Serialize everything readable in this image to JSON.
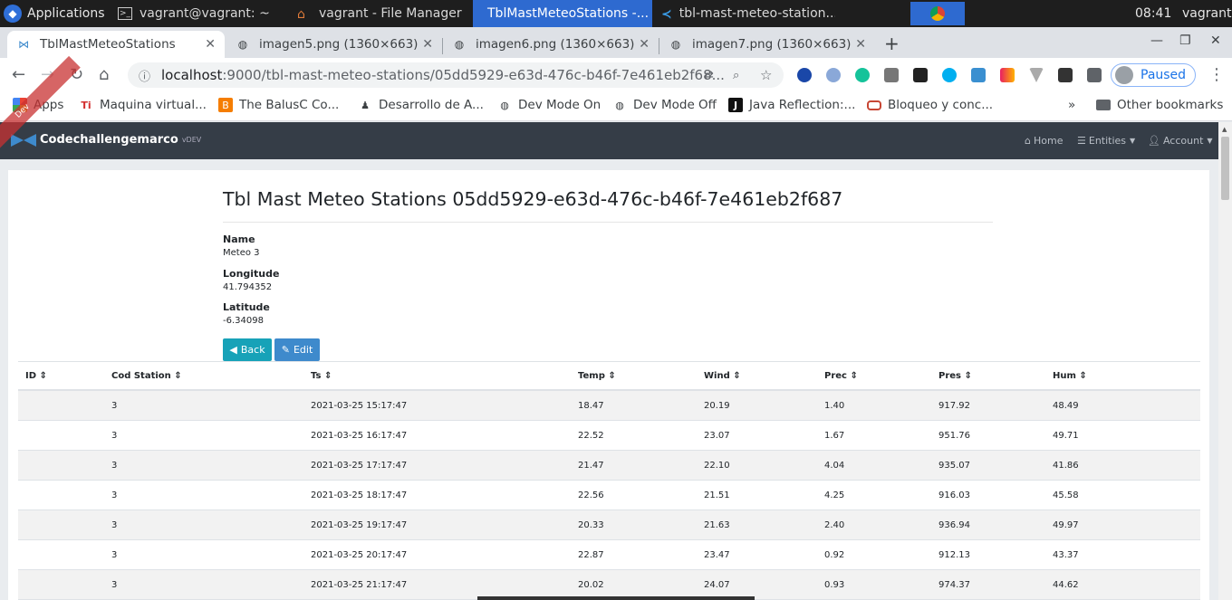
{
  "desktop": {
    "apps_label": "Applications",
    "tasks": [
      {
        "label": "vagrant@vagrant: ~",
        "icon": "terminal-icon"
      },
      {
        "label": "vagrant - File Manager",
        "icon": "home-folder-icon"
      },
      {
        "label": "TblMastMeteoStations -...",
        "icon": "chrome-icon"
      },
      {
        "label": "tbl-mast-meteo-station...",
        "icon": "vscode-icon"
      }
    ],
    "time": "08:41",
    "user": "vagrant"
  },
  "tabs": [
    {
      "label": "TblMastMeteoStations",
      "active": true
    },
    {
      "label": "imagen5.png (1360×663)"
    },
    {
      "label": "imagen6.png (1360×663)"
    },
    {
      "label": "imagen7.png (1360×663)"
    }
  ],
  "address": {
    "host": "localhost",
    "path": ":9000/tbl-mast-meteo-stations/05dd5929-e63d-476c-b46f-7e461eb2f68..."
  },
  "profile_status": "Paused",
  "bookmarks": [
    {
      "label": "Apps"
    },
    {
      "label": "Maquina virtual..."
    },
    {
      "label": "The BalusC Co..."
    },
    {
      "label": "Desarrollo de A..."
    },
    {
      "label": "Dev Mode On"
    },
    {
      "label": "Dev Mode Off"
    },
    {
      "label": "Java Reflection:..."
    },
    {
      "label": "Bloqueo y conc..."
    }
  ],
  "bookmarks_more": "»",
  "other_bookmarks": "Other bookmarks",
  "app": {
    "brand": "Codechallengemarco",
    "version": "vDEV",
    "ribbon": "Dev",
    "nav": {
      "home": "Home",
      "entities": "Entities",
      "account": "Account"
    }
  },
  "detail": {
    "title": "Tbl Mast Meteo Stations 05dd5929-e63d-476c-b46f-7e461eb2f687",
    "fields": [
      {
        "label": "Name",
        "value": "Meteo 3"
      },
      {
        "label": "Longitude",
        "value": "41.794352"
      },
      {
        "label": "Latitude",
        "value": "-6.34098"
      }
    ],
    "back_label": "Back",
    "edit_label": "Edit"
  },
  "table": {
    "columns": [
      "ID",
      "Cod Station",
      "Ts",
      "Temp",
      "Wind",
      "Prec",
      "Pres",
      "Hum"
    ],
    "rows": [
      [
        "",
        "3",
        "2021-03-25 15:17:47",
        "18.47",
        "20.19",
        "1.40",
        "917.92",
        "48.49"
      ],
      [
        "",
        "3",
        "2021-03-25 16:17:47",
        "22.52",
        "23.07",
        "1.67",
        "951.76",
        "49.71"
      ],
      [
        "",
        "3",
        "2021-03-25 17:17:47",
        "21.47",
        "22.10",
        "4.04",
        "935.07",
        "41.86"
      ],
      [
        "",
        "3",
        "2021-03-25 18:17:47",
        "22.56",
        "21.51",
        "4.25",
        "916.03",
        "45.58"
      ],
      [
        "",
        "3",
        "2021-03-25 19:17:47",
        "20.33",
        "21.63",
        "2.40",
        "936.94",
        "49.97"
      ],
      [
        "",
        "3",
        "2021-03-25 20:17:47",
        "22.87",
        "23.47",
        "0.92",
        "912.13",
        "43.37"
      ],
      [
        "",
        "3",
        "2021-03-25 21:17:47",
        "20.02",
        "24.07",
        "0.93",
        "974.37",
        "44.62"
      ]
    ]
  }
}
